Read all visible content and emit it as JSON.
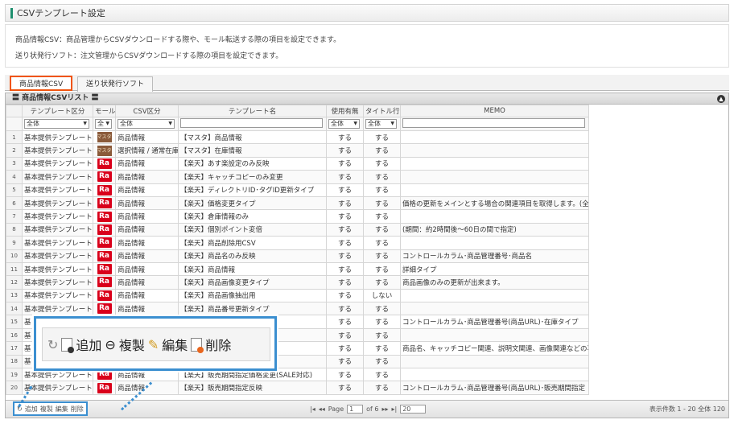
{
  "header": {
    "title": "CSVテンプレート設定"
  },
  "description": [
    "商品情報CSV：商品管理からCSVダウンロードする際や、モール転送する際の項目を設定できます。",
    "送り状発行ソフト：注文管理からCSVダウンロードする際の項目を設定できます。"
  ],
  "tabs": [
    "商品情報CSV",
    "送り状発行ソフト"
  ],
  "grid": {
    "title": "〓 商品情報CSVリスト 〓",
    "columns": [
      "テンプレート区分",
      "モール",
      "CSV区分",
      "テンプレート名",
      "使用有無",
      "タイトル行",
      "MEMO"
    ],
    "filters": [
      "全体",
      "全",
      "全体",
      "全体",
      "全体"
    ],
    "rows": [
      {
        "n": "1",
        "kubun": "基本提供テンプレート",
        "mall": "マスタ",
        "csv": "商品情報",
        "name": "【マスタ】商品情報",
        "use": "する",
        "title": "する",
        "memo": ""
      },
      {
        "n": "2",
        "kubun": "基本提供テンプレート",
        "mall": "マスタ",
        "csv": "選択情報 / 通常在庫",
        "name": "【マスタ】在庫情報",
        "use": "する",
        "title": "する",
        "memo": ""
      },
      {
        "n": "3",
        "kubun": "基本提供テンプレート",
        "mall": "Ra",
        "csv": "商品情報",
        "name": "【楽天】あす楽設定のみ反映",
        "use": "する",
        "title": "する",
        "memo": ""
      },
      {
        "n": "4",
        "kubun": "基本提供テンプレート",
        "mall": "Ra",
        "csv": "商品情報",
        "name": "【楽天】キャッチコピーのみ変更",
        "use": "する",
        "title": "する",
        "memo": ""
      },
      {
        "n": "5",
        "kubun": "基本提供テンプレート",
        "mall": "Ra",
        "csv": "商品情報",
        "name": "【楽天】ディレクトリID･タグID更新タイプ",
        "use": "する",
        "title": "する",
        "memo": ""
      },
      {
        "n": "6",
        "kubun": "基本提供テンプレート",
        "mall": "Ra",
        "csv": "商品情報",
        "name": "【楽天】価格変更タイプ",
        "use": "する",
        "title": "する",
        "memo": "価格の更新をメインとする場合の関連項目を取得します。(全商品"
      },
      {
        "n": "7",
        "kubun": "基本提供テンプレート",
        "mall": "Ra",
        "csv": "商品情報",
        "name": "【楽天】倉庫情報のみ",
        "use": "する",
        "title": "する",
        "memo": ""
      },
      {
        "n": "8",
        "kubun": "基本提供テンプレート",
        "mall": "Ra",
        "csv": "商品情報",
        "name": "【楽天】個別ポイント変倍",
        "use": "する",
        "title": "する",
        "memo": "(期間：約2時間後～60日の間で指定)"
      },
      {
        "n": "9",
        "kubun": "基本提供テンプレート",
        "mall": "Ra",
        "csv": "商品情報",
        "name": "【楽天】商品削除用CSV",
        "use": "する",
        "title": "する",
        "memo": ""
      },
      {
        "n": "10",
        "kubun": "基本提供テンプレート",
        "mall": "Ra",
        "csv": "商品情報",
        "name": "【楽天】商品名のみ反映",
        "use": "する",
        "title": "する",
        "memo": "コントロールカラム･商品管理番号･商品名"
      },
      {
        "n": "11",
        "kubun": "基本提供テンプレート",
        "mall": "Ra",
        "csv": "商品情報",
        "name": "【楽天】商品情報",
        "use": "する",
        "title": "する",
        "memo": "詳細タイプ"
      },
      {
        "n": "12",
        "kubun": "基本提供テンプレート",
        "mall": "Ra",
        "csv": "商品情報",
        "name": "【楽天】商品画像変更タイプ",
        "use": "する",
        "title": "する",
        "memo": "商品画像のみの更新が出来ます。"
      },
      {
        "n": "13",
        "kubun": "基本提供テンプレート",
        "mall": "Ra",
        "csv": "商品情報",
        "name": "【楽天】商品画像抽出用",
        "use": "する",
        "title": "しない",
        "memo": ""
      },
      {
        "n": "14",
        "kubun": "基本提供テンプレート",
        "mall": "Ra",
        "csv": "商品情報",
        "name": "【楽天】商品番号更新タイプ",
        "use": "する",
        "title": "する",
        "memo": ""
      },
      {
        "n": "15",
        "kubun": "基",
        "mall": "",
        "csv": "",
        "name": "",
        "use": "する",
        "title": "する",
        "memo": "コントロールカラム･商品管理番号(商品URL)･在庫タイプ"
      },
      {
        "n": "16",
        "kubun": "基",
        "mall": "",
        "csv": "",
        "name": "",
        "use": "する",
        "title": "する",
        "memo": ""
      },
      {
        "n": "17",
        "kubun": "基",
        "mall": "",
        "csv": "",
        "name": "プ",
        "use": "する",
        "title": "する",
        "memo": "商品名、キャッチコピー関連、説明文関連、画像関連などの項目"
      },
      {
        "n": "18",
        "kubun": "基",
        "mall": "",
        "csv": "",
        "name": "更(SALE対応)",
        "use": "する",
        "title": "する",
        "memo": ""
      },
      {
        "n": "19",
        "kubun": "基本提供テンプレート",
        "mall": "Ra",
        "csv": "商品情報",
        "name": "【楽天】販売期間指定価格変更(SALE対応)",
        "use": "する",
        "title": "する",
        "memo": ""
      },
      {
        "n": "20",
        "kubun": "基本提供テンプレート",
        "mall": "Ra",
        "csv": "商品情報",
        "name": "【楽天】販売期間指定反映",
        "use": "する",
        "title": "する",
        "memo": "コントロールカラム･商品管理番号(商品URL)･販売期間指定"
      }
    ]
  },
  "toolbar": {
    "add": "追加",
    "copy": "複製",
    "edit": "編集",
    "delete": "削除"
  },
  "pager": {
    "page_label": "Page",
    "page": "1",
    "of": "of 6",
    "per_page": "20",
    "count": "表示件数 1 - 20 全体 120"
  }
}
